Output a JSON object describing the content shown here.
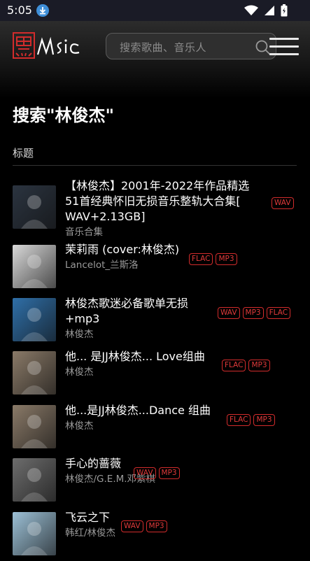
{
  "status_bar": {
    "time": "5:05"
  },
  "header": {
    "logo_text": "MUSIC",
    "search_placeholder": "搜索歌曲、音乐人"
  },
  "page": {
    "title": "搜索\"林俊杰\"",
    "section_label": "标题"
  },
  "results": [
    {
      "title_lines": [
        "【林俊杰】2001年-2022年作品精选",
        "51首经典怀旧无损音乐整轨大合集[",
        "WAV+2.13GB]"
      ],
      "subtitle": "音乐合集",
      "badges": [
        "WAV"
      ],
      "thumb_color": "#2b3440"
    },
    {
      "title_lines": [
        "茉莉雨 (cover:林俊杰)"
      ],
      "subtitle": "Lancelot_兰斯洛",
      "badges": [
        "FLAC",
        "MP3"
      ],
      "thumb_color": "#d9d9d9"
    },
    {
      "title_lines": [
        "林俊杰歌迷必备歌单无损",
        "+mp3"
      ],
      "subtitle": "林俊杰",
      "badges": [
        "WAV",
        "MP3",
        "FLAC"
      ],
      "thumb_color": "#2f6fa8"
    },
    {
      "title_lines": [
        "他... 是JJ林俊杰... Love组曲"
      ],
      "subtitle": "林俊杰",
      "badges": [
        "FLAC",
        "MP3"
      ],
      "thumb_color": "#8a7a68"
    },
    {
      "title_lines": [
        "他...是JJ林俊杰...Dance 组曲"
      ],
      "subtitle": "林俊杰",
      "badges": [
        "FLAC",
        "MP3"
      ],
      "thumb_color": "#8a7a68"
    },
    {
      "title_lines": [
        "手心的蔷薇"
      ],
      "subtitle": "林俊杰/G.E.M.邓紫棋",
      "badges": [
        "WAV",
        "MP3"
      ],
      "thumb_color": "#6d6d6d"
    },
    {
      "title_lines": [
        "飞云之下"
      ],
      "subtitle": "韩红/林俊杰",
      "badges": [
        "WAV",
        "MP3"
      ],
      "thumb_color": "#9cc0d6"
    }
  ]
}
